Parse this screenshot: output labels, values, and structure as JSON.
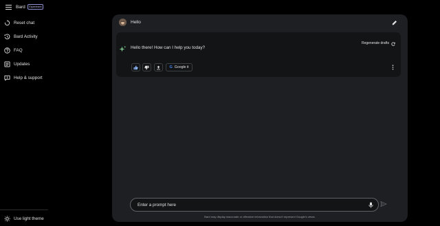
{
  "app": {
    "name": "Bard",
    "badge": "Experiment"
  },
  "sidebar": {
    "items": [
      {
        "label": "Reset chat",
        "icon": "reset-icon"
      },
      {
        "label": "Bard Activity",
        "icon": "history-icon"
      },
      {
        "label": "FAQ",
        "icon": "help-circle-icon"
      },
      {
        "label": "Updates",
        "icon": "updates-icon"
      },
      {
        "label": "Help & support",
        "icon": "support-icon"
      }
    ],
    "theme_toggle": {
      "label": "Use light theme",
      "icon": "sun-icon"
    }
  },
  "conversation": {
    "user_prompt": "Hello",
    "response": {
      "text": "Hello there! How can I help you today?",
      "regenerate_label": "Regenerate drafts",
      "actions": {
        "google_it_label": "Google it",
        "google_letter": "G"
      }
    }
  },
  "composer": {
    "placeholder": "Enter a prompt here",
    "disclaimer": "Bard may display inaccurate or offensive information that doesn't represent Google's views."
  },
  "colors": {
    "background": "#000000",
    "panel": "#1e1f22",
    "card": "#131416",
    "text": "#e3e3e3",
    "sparkle": "#7cc48b",
    "google_blue": "#4285f4"
  }
}
